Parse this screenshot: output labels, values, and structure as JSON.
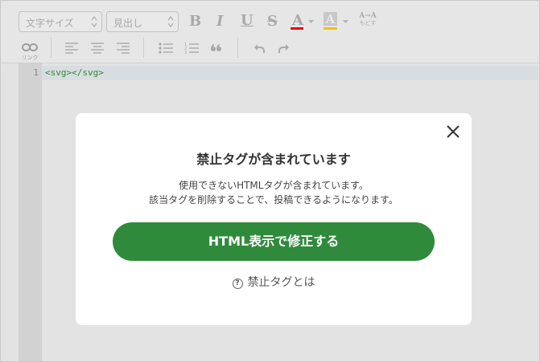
{
  "toolbar": {
    "font_select": "文字サイズ",
    "heading_select": "見出し",
    "bold": "B",
    "italic": "I",
    "underline": "U",
    "strike": "S",
    "text_color": "A",
    "bg_color": "A",
    "undo_format_top": "A→A",
    "undo_format_bottom": "もどす",
    "link_label": "リンク",
    "colors": {
      "text_color_bar": "#e60012",
      "bg_color_bar": "#f2c200"
    }
  },
  "editor": {
    "line_number": "1",
    "code": "<svg></svg>"
  },
  "dialog": {
    "title": "禁止タグが含まれています",
    "message_line1": "使用できないHTMLタグが含まれています。",
    "message_line2": "該当タグを削除することで、投稿できるようになります。",
    "primary_button": "HTML表示で修正する",
    "help_link": "禁止タグとは",
    "accent_color": "#2f8a3b"
  }
}
